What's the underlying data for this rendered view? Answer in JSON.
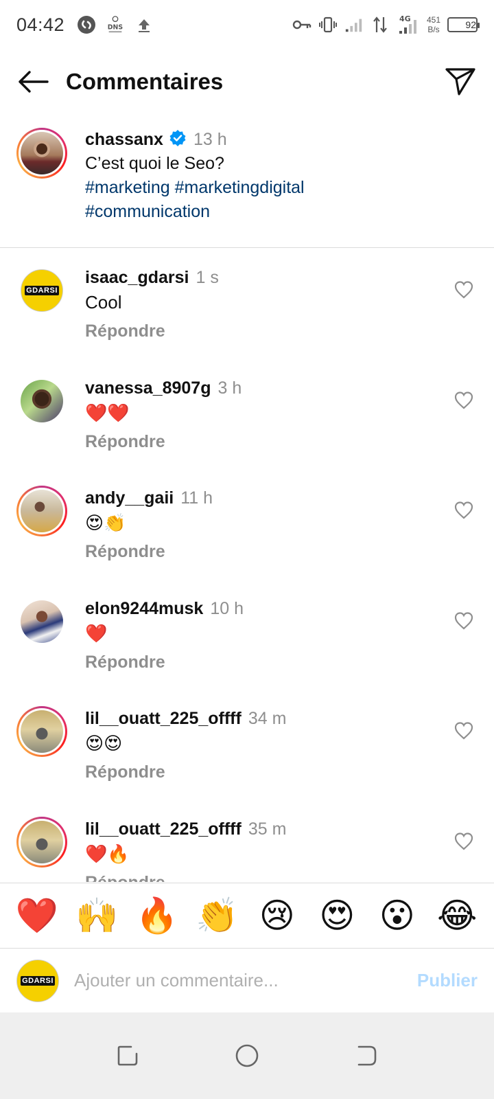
{
  "status_bar": {
    "time": "04:42",
    "net_speed_value": "451",
    "net_speed_unit": "B/s",
    "network_type": "4G",
    "battery": "92"
  },
  "header": {
    "title": "Commentaires"
  },
  "post": {
    "username": "chassanx",
    "verified": true,
    "time": "13 h",
    "text": "C’est quoi le Seo?",
    "hashtags_line1": "#marketing #marketingdigital",
    "hashtags_line2": "#communication"
  },
  "comments": [
    {
      "username": "isaac_gdarsi",
      "time": "1 s",
      "text": "Cool",
      "reply": "Répondre"
    },
    {
      "username": "vanessa_8907g",
      "time": "3 h",
      "text": "❤️❤️",
      "reply": "Répondre"
    },
    {
      "username": "andy__gaii",
      "time": "11 h",
      "text": "😍👏",
      "reply": "Répondre"
    },
    {
      "username": "elon9244musk",
      "time": "10 h",
      "text": "❤️",
      "reply": "Répondre"
    },
    {
      "username": "lil__ouatt_225_offff",
      "time": "34 m",
      "text": "😍😍",
      "reply": "Répondre"
    },
    {
      "username": "lil__ouatt_225_offff",
      "time": "35 m",
      "text": "❤️🔥",
      "reply": "Répondre"
    }
  ],
  "avatar_logo_text": "GDARSI",
  "emoji_reactions": [
    "❤️",
    "🙌",
    "🔥",
    "👏",
    "😢",
    "😍",
    "😮",
    "😂"
  ],
  "comment_input": {
    "placeholder": "Ajouter un commentaire...",
    "submit_label": "Publier"
  },
  "colors": {
    "hashtag": "#00376b",
    "publish_disabled": "#b3dbff",
    "secondary_text": "#8e8e8e",
    "verified_badge": "#0095f6"
  }
}
